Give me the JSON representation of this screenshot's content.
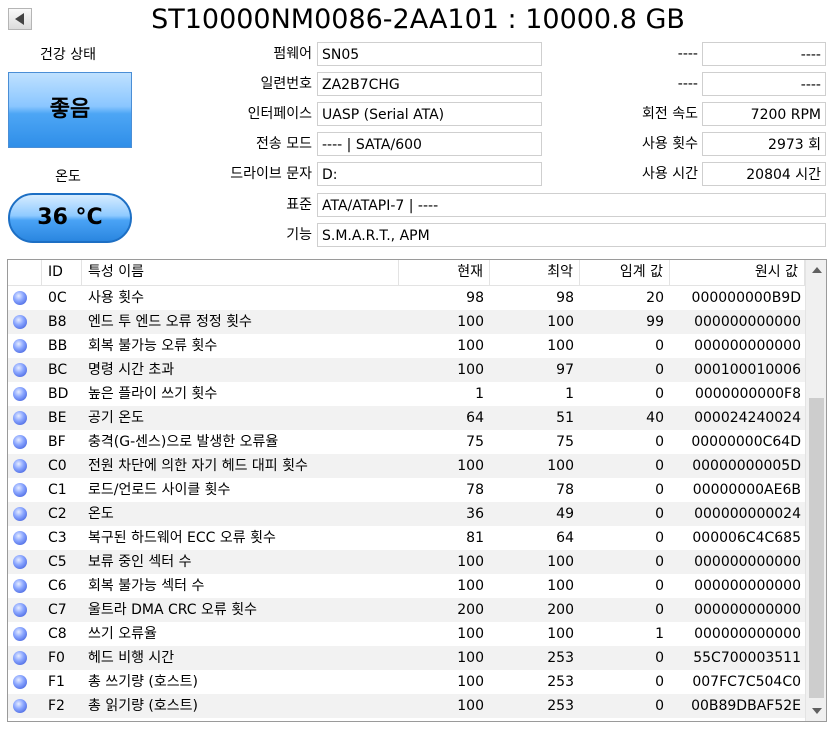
{
  "header": {
    "title": "ST10000NM0086-2AA101 : 10000.8 GB"
  },
  "health": {
    "label": "건강 상태",
    "status": "좋음"
  },
  "temperature": {
    "label": "온도",
    "value": "36 °C"
  },
  "info": {
    "firmware": {
      "label": "펌웨어",
      "value": "SN05"
    },
    "serial": {
      "label": "일련번호",
      "value": "ZA2B7CHG"
    },
    "interface": {
      "label": "인터페이스",
      "value": "UASP (Serial ATA)"
    },
    "transfer_mode": {
      "label": "전송 모드",
      "value": "---- | SATA/600"
    },
    "drive_letter": {
      "label": "드라이브 문자",
      "value": "D:"
    },
    "standard": {
      "label": "표준",
      "value": "ATA/ATAPI-7 | ----"
    },
    "features": {
      "label": "기능",
      "value": "S.M.A.R.T., APM"
    },
    "right1": {
      "label": "----",
      "value": "----"
    },
    "right2": {
      "label": "----",
      "value": "----"
    },
    "rotation": {
      "label": "회전 속도",
      "value": "7200 RPM"
    },
    "power_on_count": {
      "label": "사용 횟수",
      "value": "2973 회"
    },
    "power_on_hours": {
      "label": "사용 시간",
      "value": "20804 시간"
    }
  },
  "table": {
    "columns": {
      "id": "ID",
      "name": "특성 이름",
      "current": "현재",
      "worst": "최악",
      "threshold": "임계 값",
      "raw": "원시 값"
    },
    "rows": [
      {
        "id": "0C",
        "name": "사용 횟수",
        "current": "98",
        "worst": "98",
        "threshold": "20",
        "raw": "000000000B9D"
      },
      {
        "id": "B8",
        "name": "엔드 투 엔드 오류 정정 횟수",
        "current": "100",
        "worst": "100",
        "threshold": "99",
        "raw": "000000000000"
      },
      {
        "id": "BB",
        "name": "회복 불가능 오류 횟수",
        "current": "100",
        "worst": "100",
        "threshold": "0",
        "raw": "000000000000"
      },
      {
        "id": "BC",
        "name": "명령 시간 초과",
        "current": "100",
        "worst": "97",
        "threshold": "0",
        "raw": "000100010006"
      },
      {
        "id": "BD",
        "name": "높은 플라이 쓰기 횟수",
        "current": "1",
        "worst": "1",
        "threshold": "0",
        "raw": "0000000000F8"
      },
      {
        "id": "BE",
        "name": "공기 온도",
        "current": "64",
        "worst": "51",
        "threshold": "40",
        "raw": "000024240024"
      },
      {
        "id": "BF",
        "name": "충격(G-센스)으로 발생한 오류율",
        "current": "75",
        "worst": "75",
        "threshold": "0",
        "raw": "00000000C64D"
      },
      {
        "id": "C0",
        "name": "전원 차단에 의한 자기 헤드 대피 횟수",
        "current": "100",
        "worst": "100",
        "threshold": "0",
        "raw": "00000000005D"
      },
      {
        "id": "C1",
        "name": "로드/언로드 사이클 횟수",
        "current": "78",
        "worst": "78",
        "threshold": "0",
        "raw": "00000000AE6B"
      },
      {
        "id": "C2",
        "name": "온도",
        "current": "36",
        "worst": "49",
        "threshold": "0",
        "raw": "000000000024"
      },
      {
        "id": "C3",
        "name": "복구된 하드웨어 ECC 오류 횟수",
        "current": "81",
        "worst": "64",
        "threshold": "0",
        "raw": "000006C4C685"
      },
      {
        "id": "C5",
        "name": "보류 중인 섹터 수",
        "current": "100",
        "worst": "100",
        "threshold": "0",
        "raw": "000000000000"
      },
      {
        "id": "C6",
        "name": "회복 불가능 섹터 수",
        "current": "100",
        "worst": "100",
        "threshold": "0",
        "raw": "000000000000"
      },
      {
        "id": "C7",
        "name": "울트라 DMA CRC 오류 횟수",
        "current": "200",
        "worst": "200",
        "threshold": "0",
        "raw": "000000000000"
      },
      {
        "id": "C8",
        "name": "쓰기 오류율",
        "current": "100",
        "worst": "100",
        "threshold": "1",
        "raw": "000000000000"
      },
      {
        "id": "F0",
        "name": "헤드 비행 시간",
        "current": "100",
        "worst": "253",
        "threshold": "0",
        "raw": "55C700003511"
      },
      {
        "id": "F1",
        "name": "총 쓰기량 (호스트)",
        "current": "100",
        "worst": "253",
        "threshold": "0",
        "raw": "007FC7C504C0"
      },
      {
        "id": "F2",
        "name": "총 읽기량 (호스트)",
        "current": "100",
        "worst": "253",
        "threshold": "0",
        "raw": "00B89DBAF52E"
      }
    ]
  }
}
